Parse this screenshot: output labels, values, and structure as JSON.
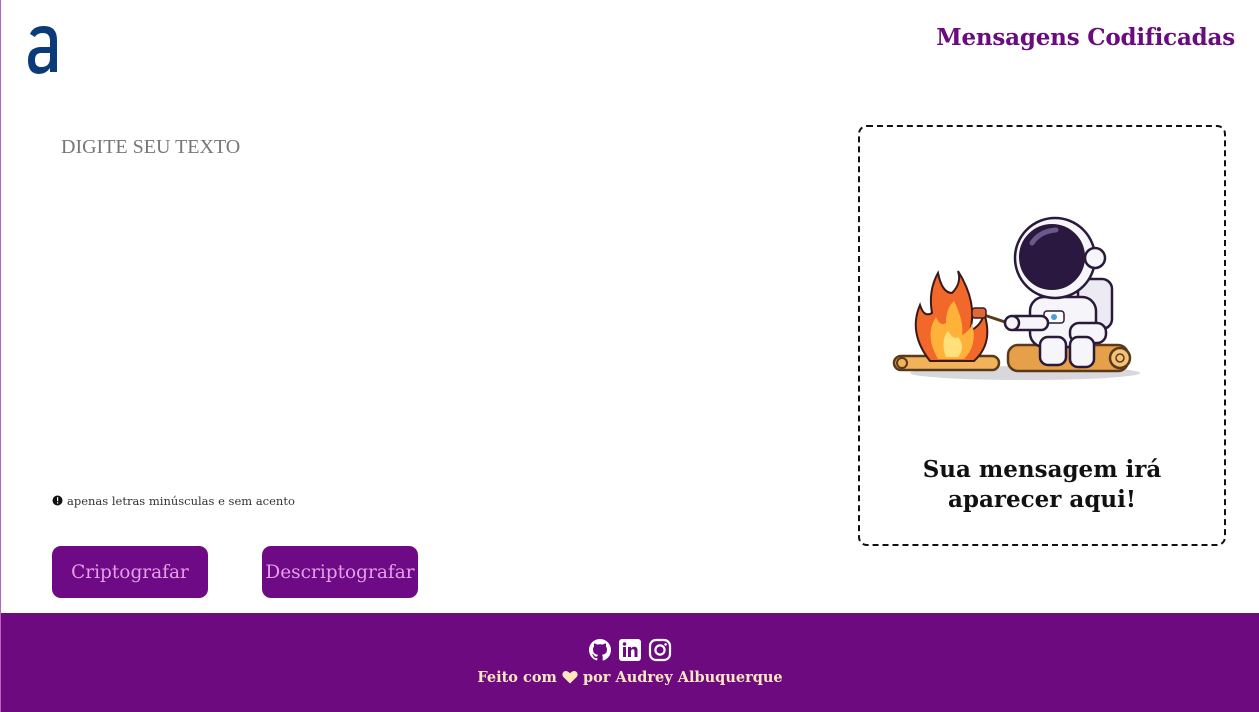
{
  "header": {
    "logo_icon": "stylized-a-logo",
    "title": "Mensagens Codificadas"
  },
  "input": {
    "placeholder": "DIGITE SEU TEXTO",
    "value": ""
  },
  "hint": {
    "icon": "info-circle-icon",
    "text": "apenas letras minúsculas e sem acento"
  },
  "buttons": {
    "encrypt_label": "Criptografar",
    "decrypt_label": "Descriptografar"
  },
  "output": {
    "illustration": "astronaut-campfire-illustration",
    "message": "Sua mensagem irá aparecer aqui!"
  },
  "footer": {
    "social": [
      "github-icon",
      "linkedin-icon",
      "instagram-icon"
    ],
    "credits_prefix": "Feito com",
    "credits_suffix": "por Audrey Albuquerque"
  },
  "colors": {
    "brand_purple": "#6e0a85",
    "button_text": "#e59fe8",
    "logo_blue": "#0c3b7a",
    "footer_text": "#ffe7c0"
  }
}
